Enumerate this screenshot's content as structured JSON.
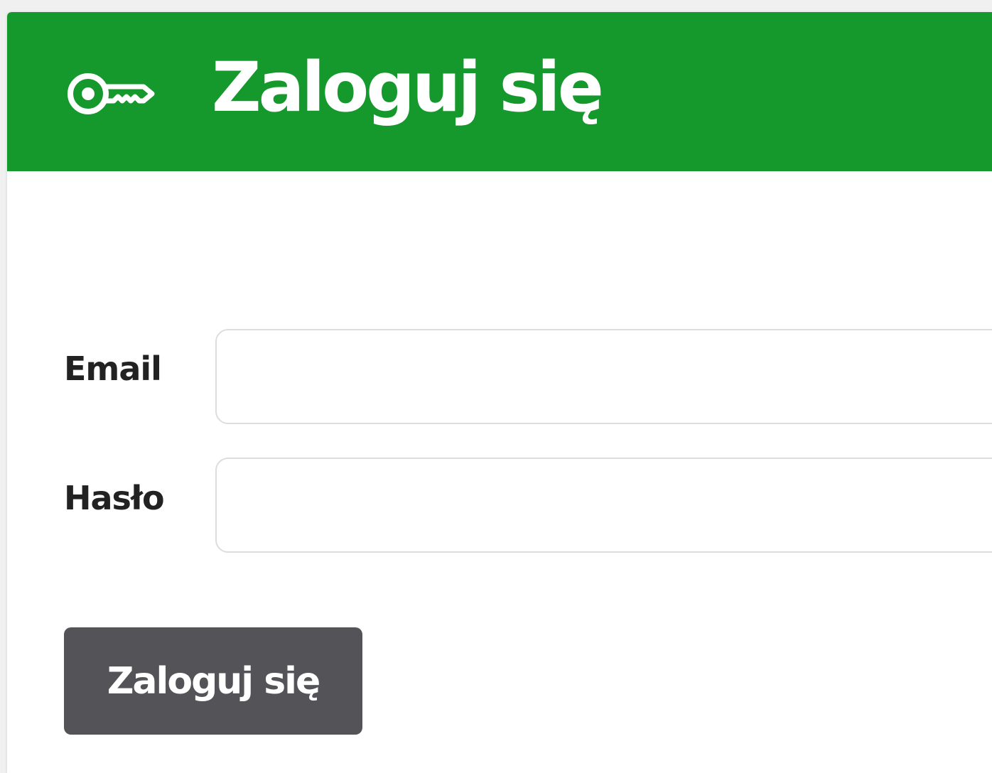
{
  "header": {
    "icon": "key-icon",
    "title": "Zaloguj się",
    "background_color": "#15992c"
  },
  "form": {
    "email": {
      "label": "Email",
      "value": "",
      "placeholder": ""
    },
    "password": {
      "label": "Hasło",
      "value": "",
      "placeholder": ""
    },
    "submit_label": "Zaloguj się",
    "submit_color": "#545458"
  }
}
